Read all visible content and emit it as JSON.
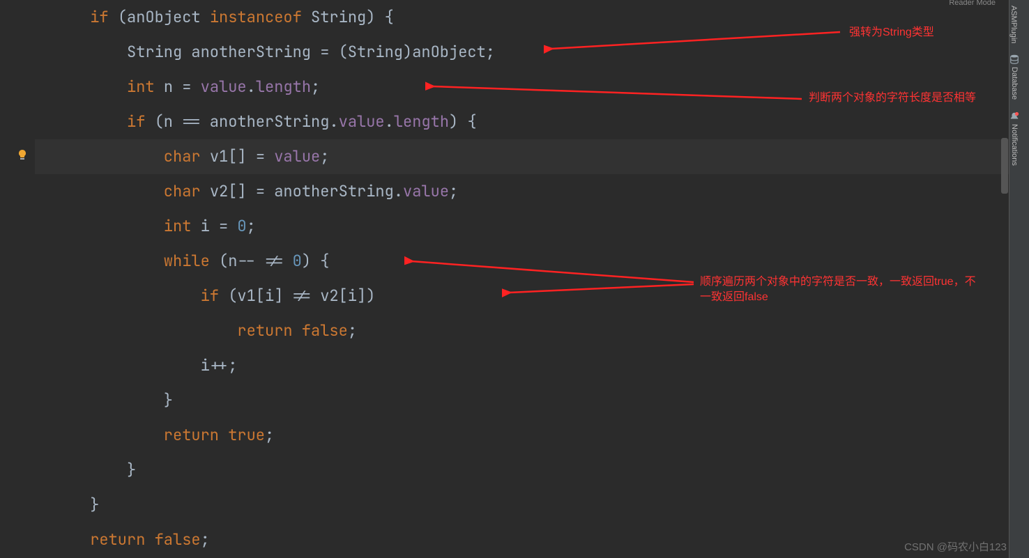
{
  "reader_mode": "Reader Mode",
  "code": {
    "l1": "      if (anObject instanceof String) {",
    "l2": "          String anotherString = (String)anObject;",
    "l3": "          int n = value.length;",
    "l4": "          if (n == anotherString.value.length) {",
    "l5": "              char v1[] = value;",
    "l6": "              char v2[] = anotherString.value;",
    "l7": "              int i = 0;",
    "l8": "              while (n-- != 0) {",
    "l9": "                  if (v1[i] != v2[i])",
    "l10": "                      return false;",
    "l11": "                  i++;",
    "l12": "              }",
    "l13": "              return true;",
    "l14": "          }",
    "l15": "      }",
    "l16": "      return false;"
  },
  "annotations": {
    "a1": "强转为String类型",
    "a2": "判断两个对象的字符长度是否相等",
    "a3": "顺序遍历两个对象中的字符是否一致，一致返回true，不一致返回false"
  },
  "sidebar": {
    "asm": "ASMPlugin",
    "db": "Database",
    "notif": "Notifications"
  },
  "watermark": "CSDN @码农小白123"
}
